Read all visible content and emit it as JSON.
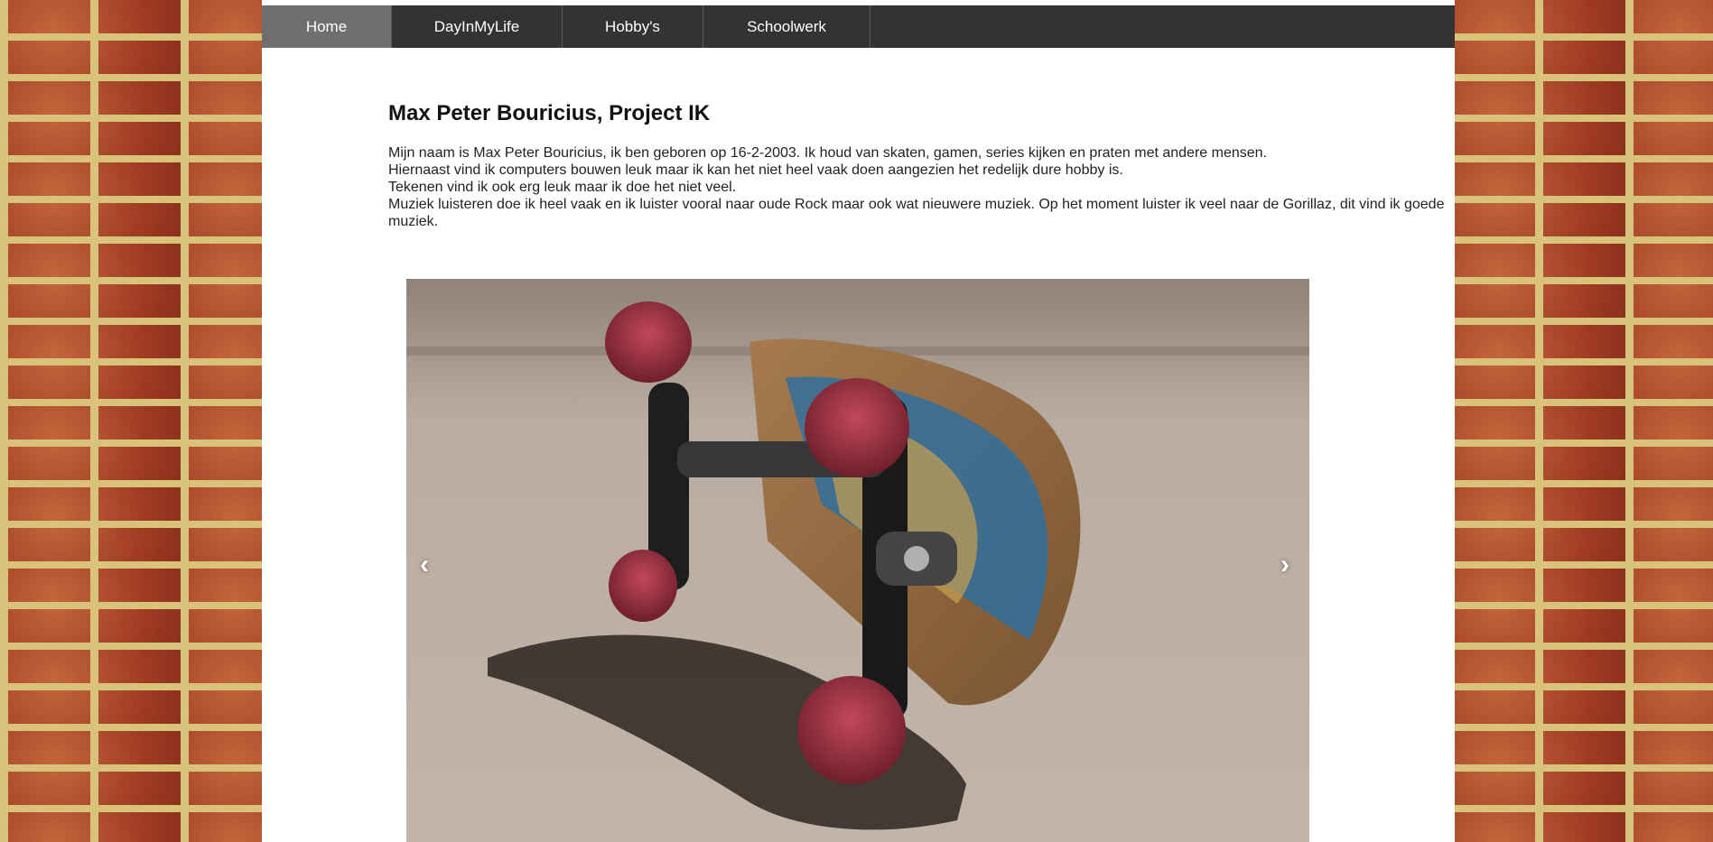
{
  "nav": {
    "items": [
      {
        "label": "Home",
        "active": true
      },
      {
        "label": "DayInMyLife",
        "active": false
      },
      {
        "label": "Hobby's",
        "active": false
      },
      {
        "label": "Schoolwerk",
        "active": false
      }
    ]
  },
  "main": {
    "title": "Max Peter Bouricius, Project IK",
    "paragraphs": [
      "Mijn naam is Max Peter Bouricius, ik ben geboren op 16-2-2003. Ik houd van skaten, gamen, series kijken en praten met andere mensen.",
      "Hiernaast vind ik computers bouwen leuk maar ik kan het niet heel vaak doen aangezien het redelijk dure hobby is.",
      "Tekenen vind ik ook erg leuk maar ik doe het niet veel.",
      "Muziek luisteren doe ik heel vaak en ik luister vooral naar oude Rock maar ook wat nieuwere muziek. Op het moment luister ik veel naar de Gorillaz, dit vind ik goede muziek."
    ]
  },
  "carousel": {
    "prev_label": "‹",
    "next_label": "›"
  },
  "colors": {
    "navbar": "#333333",
    "nav_active": "#6f6f6f",
    "content_bg": "#ffffff",
    "brick": "#b4502e",
    "mortar": "#d9c27a"
  }
}
